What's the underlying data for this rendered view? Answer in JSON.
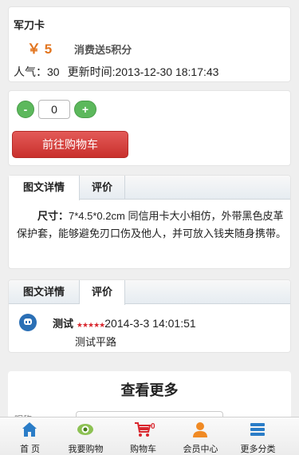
{
  "product": {
    "name": "军刀卡",
    "price": "￥ 5",
    "points": "消费送5积分",
    "popularity_label": "人气：",
    "popularity_value": "30",
    "updated_label": "更新时间:",
    "updated_value": "2013-12-30 18:17:43"
  },
  "cart": {
    "minus": "-",
    "quantity": "0",
    "plus": "+",
    "go_cart": "前往购物车"
  },
  "detail_section": {
    "tabs": [
      "图文详情",
      "评价"
    ],
    "size_label": "尺寸：",
    "size_text": "7*4.5*0.2cm 同信用卡大小相仿，外带黑色皮革保护套，能够避免刃口伤及他人，并可放入钱夹随身携带。"
  },
  "review_section": {
    "tabs": [
      "图文详情",
      "评价"
    ],
    "user": "测试",
    "stars": "★★★★★",
    "date": "2014-3-3 14:01:51",
    "comment": "测试平路"
  },
  "more": {
    "title": "查看更多",
    "field_label": "昵称"
  },
  "nav": {
    "items": [
      {
        "label": "首 页",
        "icon": "home-icon"
      },
      {
        "label": "我要购物",
        "icon": "eye-icon"
      },
      {
        "label": "购物车",
        "icon": "cart-icon",
        "badge": "0"
      },
      {
        "label": "会员中心",
        "icon": "user-icon"
      },
      {
        "label": "更多分类",
        "icon": "list-icon"
      }
    ]
  },
  "colors": {
    "price": "#e2751f",
    "green_button": "#5cb85c",
    "red_button": "#c9302c",
    "stars": "#d9272e"
  }
}
